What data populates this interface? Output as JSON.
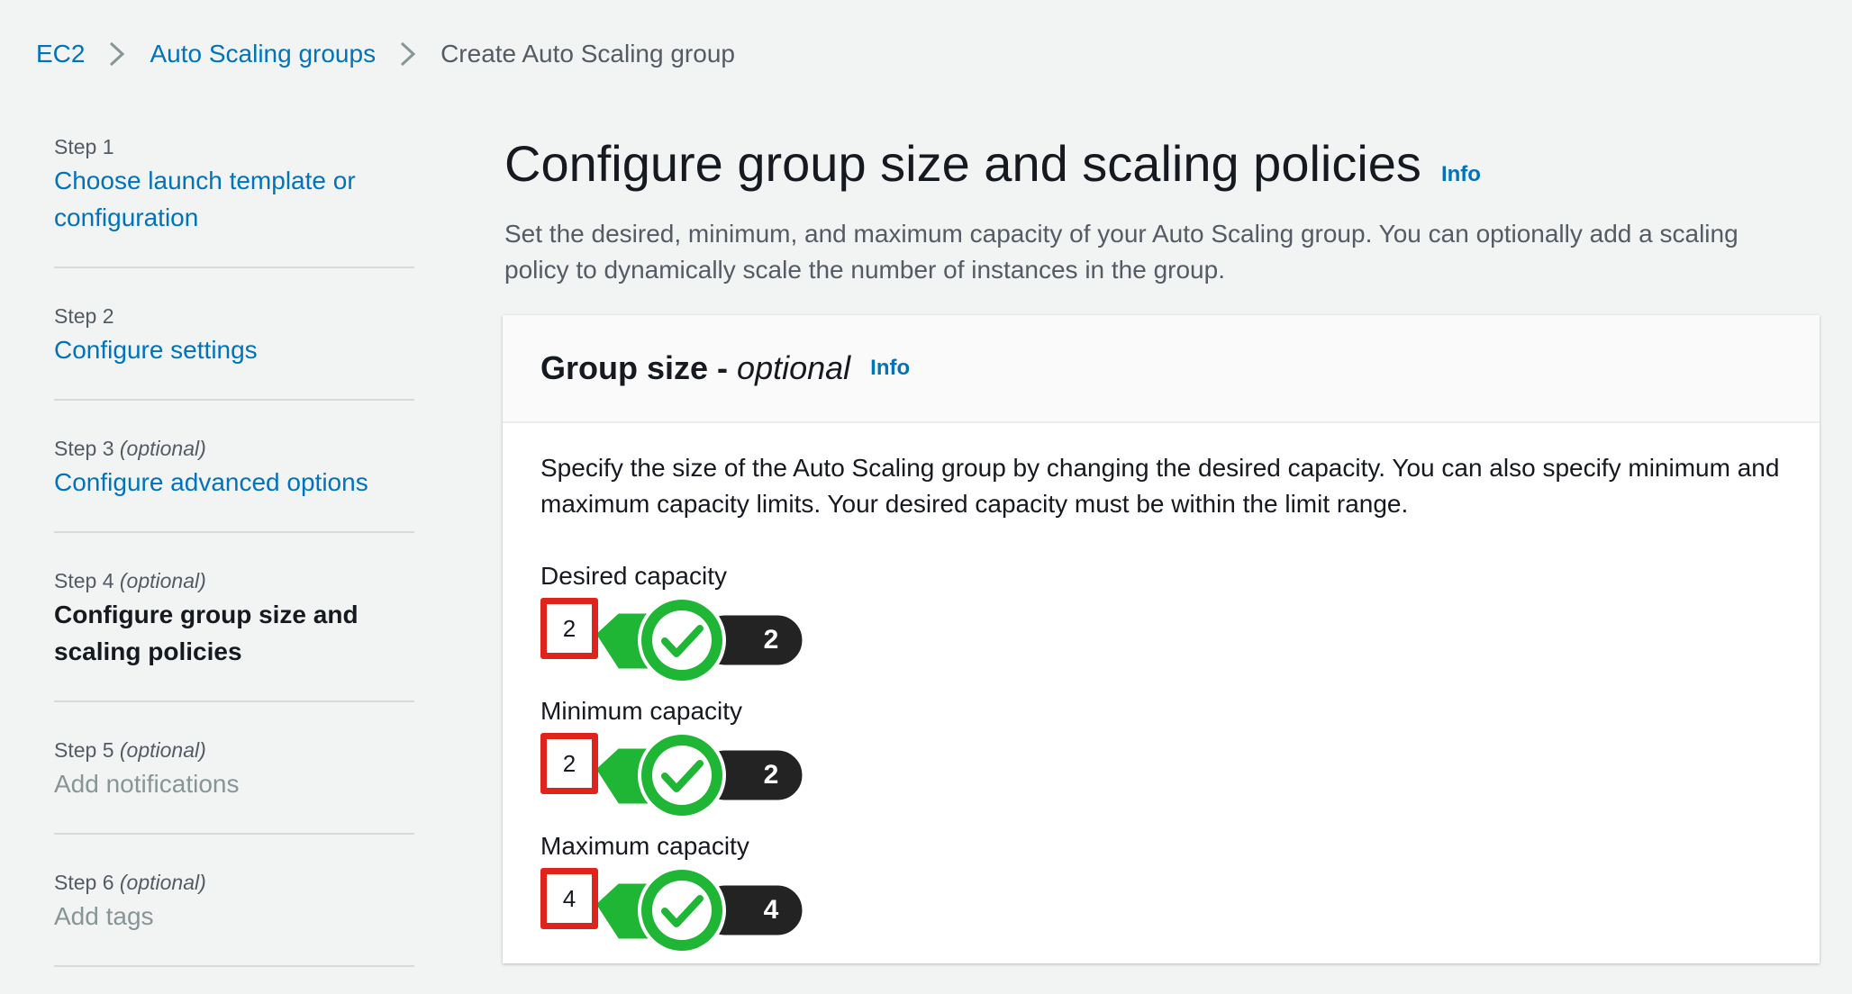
{
  "breadcrumb": {
    "items": [
      {
        "label": "EC2"
      },
      {
        "label": "Auto Scaling groups"
      },
      {
        "label": "Create Auto Scaling group"
      }
    ]
  },
  "steps": [
    {
      "step": "Step 1",
      "optional": "",
      "title": "Choose launch template or configuration",
      "state": "link"
    },
    {
      "step": "Step 2",
      "optional": "",
      "title": "Configure settings",
      "state": "link"
    },
    {
      "step": "Step 3",
      "optional": "(optional)",
      "title": "Configure advanced options",
      "state": "link"
    },
    {
      "step": "Step 4",
      "optional": "(optional)",
      "title": "Configure group size and scaling policies",
      "state": "current"
    },
    {
      "step": "Step 5",
      "optional": "(optional)",
      "title": "Add notifications",
      "state": "disabled"
    },
    {
      "step": "Step 6",
      "optional": "(optional)",
      "title": "Add tags",
      "state": "disabled"
    }
  ],
  "page": {
    "title": "Configure group size and scaling policies",
    "info": "Info",
    "description": "Set the desired, minimum, and maximum capacity of your Auto Scaling group. You can optionally add a scaling policy to dynamically scale the number of instances in the group."
  },
  "group_size": {
    "title": "Group size -",
    "title_suffix": "optional",
    "info": "Info",
    "description": "Specify the size of the Auto Scaling group by changing the desired capacity. You can also specify minimum and maximum capacity limits. Your desired capacity must be within the limit range.",
    "fields": [
      {
        "label": "Desired capacity",
        "value": "2",
        "count": "2"
      },
      {
        "label": "Minimum capacity",
        "value": "2",
        "count": "2"
      },
      {
        "label": "Maximum capacity",
        "value": "4",
        "count": "4"
      }
    ]
  },
  "colors": {
    "link": "#0073bb",
    "highlight_red": "#e0241b",
    "check_green": "#1fb535",
    "count_badge": "#232323"
  },
  "icons": [
    "chevron-right-icon",
    "checkmark-icon"
  ]
}
